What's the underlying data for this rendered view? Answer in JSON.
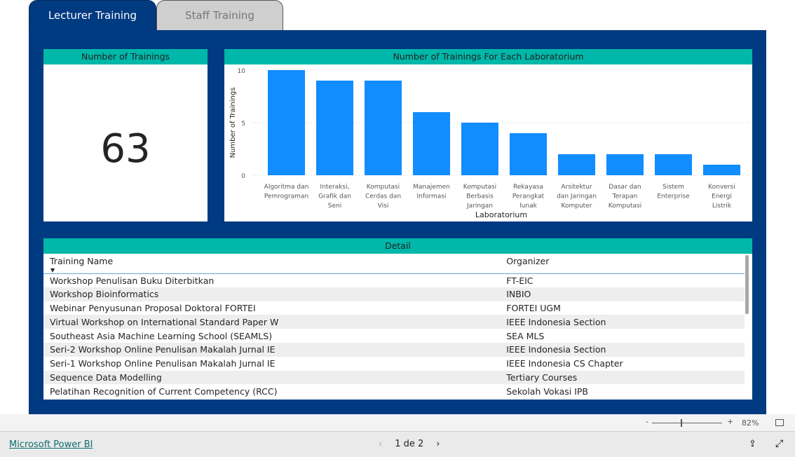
{
  "tabs": [
    {
      "label": "Lecturer Training",
      "active": true
    },
    {
      "label": "Staff Training",
      "active": false
    }
  ],
  "kpi": {
    "title": "Number of Trainings",
    "value": "63"
  },
  "chart_data": {
    "type": "bar",
    "title": "Number of Trainings For Each Laboratorium",
    "xlabel": "Laboratorium",
    "ylabel": "Number of Trainings",
    "ylim": [
      0,
      10
    ],
    "yticks": [
      "0",
      "5",
      "10"
    ],
    "grid": true,
    "color": "#118dff",
    "categories": [
      "Algoritma dan Pemrograman",
      "Interaksi, Grafik dan Seni",
      "Komputasi Cerdas dan Visi",
      "Manajemen Informasi",
      "Komputasi Berbasis Jaringan",
      "Rekayasa Perangkat lunak",
      "Arsitektur dan Jaringan Komputer",
      "Dasar dan Terapan Komputasi",
      "Sistem Enterprise",
      "Konversi Energi Listrik"
    ],
    "values": [
      10,
      9,
      9,
      6,
      5,
      4,
      2,
      2,
      2,
      1
    ]
  },
  "detail": {
    "title": "Detail",
    "columns": [
      "Training Name",
      "Organizer"
    ],
    "rows": [
      [
        "Workshop Penulisan Buku Diterbitkan",
        "FT-EIC"
      ],
      [
        "Workshop Bioinformatics",
        "INBIO"
      ],
      [
        "Webinar Penyusunan Proposal Doktoral FORTEI",
        "FORTEI UGM"
      ],
      [
        "Virtual Workshop on International Standard Paper W",
        "IEEE Indonesia Section"
      ],
      [
        "Southeast Asia Machine Learning School (SEAMLS)",
        "SEA MLS"
      ],
      [
        "Seri-2 Workshop Online Penulisan Makalah Jurnal IE",
        "IEEE Indonesia Section"
      ],
      [
        "Seri-1 Workshop Online Penulisan Makalah Jurnal IE",
        "IEEE Indonesia CS Chapter"
      ],
      [
        "Sequence Data Modelling",
        "Tertiary Courses"
      ],
      [
        "Pelatihan Recognition of Current Competency (RCC)",
        "Sekolah Vokasi IPB"
      ]
    ]
  },
  "zoom": {
    "minus": "-",
    "plus": "+",
    "level": "82%",
    "percent": 82
  },
  "footer": {
    "brand": "Microsoft Power BI",
    "page": "1 de 2",
    "prev": "‹",
    "next": "›"
  }
}
